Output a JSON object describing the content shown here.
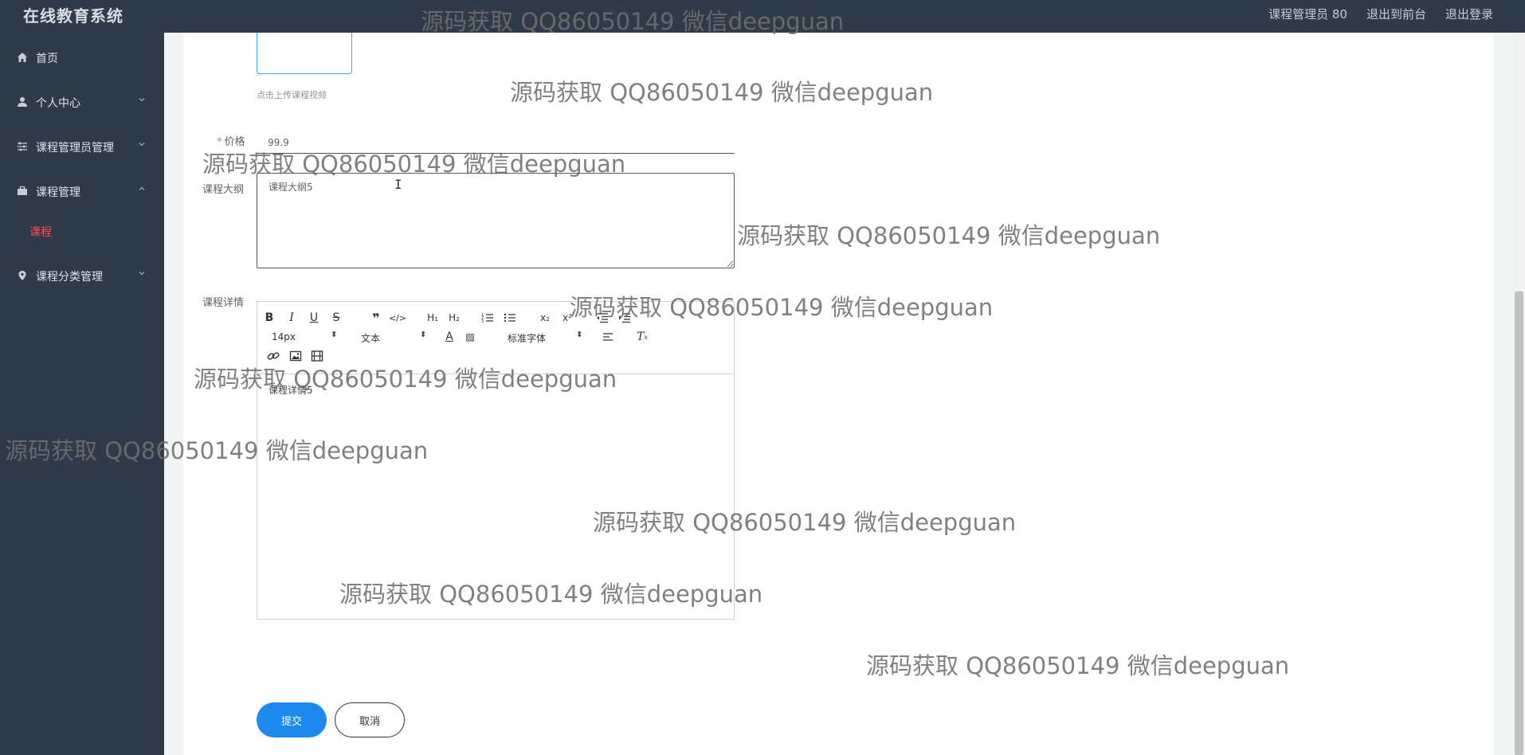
{
  "header": {
    "app_title": "在线教育系统",
    "user_label": "课程管理员 80",
    "front_link": "退出到前台",
    "logout_link": "退出登录"
  },
  "sidebar": {
    "items": [
      {
        "label": "首页",
        "icon": "home-icon"
      },
      {
        "label": "个人中心",
        "icon": "user-icon"
      },
      {
        "label": "课程管理员管理",
        "icon": "sliders-icon"
      },
      {
        "label": "课程管理",
        "icon": "briefcase-icon"
      },
      {
        "label": "课程分类管理",
        "icon": "map-pin-icon"
      }
    ],
    "submenu": {
      "active_label": "课程"
    },
    "active_color": "#ff4a53"
  },
  "form": {
    "upload_hint": "点击上传课程视频",
    "price_label": "价格",
    "price_required_mark": "*",
    "price_value": "99.9",
    "outline_label": "课程大纲",
    "outline_value": "课程大纲5",
    "details_label": "课程详情",
    "details_value": "课程详情5",
    "editor_toolbar": {
      "size_select": "14px",
      "header_select": "文本",
      "font_select": "标准字体"
    },
    "submit_label": "提交",
    "cancel_label": "取消"
  },
  "watermarks": [
    "源码获取 QQ86050149 微信deepguan",
    "源码获取 QQ86050149 微信deepguan",
    "源码获取 QQ86050149 微信deepguan",
    "源码获取 QQ86050149 微信deepguan",
    "源码获取 QQ86050149 微信deepguan",
    "源码获取 QQ86050149 微信deepguan",
    "源码获取 QQ86050149 微信deepguan",
    "源码获取 QQ86050149 微信deepguan",
    "源码获取 QQ86050149 微信deepguan",
    "源码获取 QQ86050149 微信deepguan"
  ],
  "colors": {
    "topbar_bg": "#303b49",
    "primary": "#1e88f1"
  }
}
